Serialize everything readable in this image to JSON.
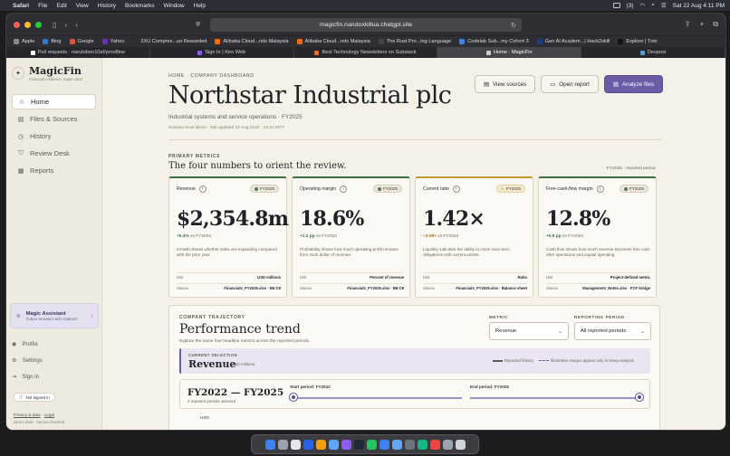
{
  "menubar": {
    "apple": "",
    "items": [
      "Safari",
      "File",
      "Edit",
      "View",
      "History",
      "Bookmarks",
      "Window",
      "Help"
    ],
    "status_badge": "(3)",
    "clock": "Sat 22 Aug 4:11 PM"
  },
  "browser": {
    "url": "magicfin.narutoxkillua.chatgpt.site",
    "bookmarks": [
      {
        "label": "Apple",
        "color": "#888888"
      },
      {
        "label": "Bing",
        "color": "#2b7cd3"
      },
      {
        "label": "Google",
        "color": "#e0523f"
      },
      {
        "label": "Yahoo",
        "color": "#6b2fb2"
      },
      {
        "label": "2XU Compres...un Rewarded",
        "color": "#2f2f2f"
      },
      {
        "label": "Alibaba Cloud...nds Malaysia",
        "color": "#ff6a00"
      },
      {
        "label": "Alibaba Cloud...nds Malaysia",
        "color": "#ff6a00"
      },
      {
        "label": "The Rust Pro...ing Language",
        "color": "#444444"
      },
      {
        "label": "Codelab Sub...my Cohort 3",
        "color": "#3b82f6"
      },
      {
        "label": "Gen AI Academ...| Hack2skill",
        "color": "#1e3a8a"
      },
      {
        "label": "Explore | Tnkr",
        "color": "#111111"
      }
    ],
    "tabs": [
      {
        "label": "Pull requests · narutoben10af/proofline",
        "color": "#ffffff",
        "active": false
      },
      {
        "label": "Sign In | Kiro Web",
        "color": "#8b5cf6",
        "active": false
      },
      {
        "label": "Best Technology Newsletters on Substack",
        "color": "#ff6719",
        "active": false
      },
      {
        "label": "Home · MagicFin",
        "color": "#cccccc",
        "active": true
      },
      {
        "label": "Devpost",
        "color": "#4d9de0",
        "active": false
      }
    ]
  },
  "sidebar": {
    "logo_glyph": "✦",
    "brand": "MagicFin",
    "tagline": "Financial evidence, made clear",
    "nav": [
      {
        "label": "Home",
        "icon": "⌂",
        "active": true
      },
      {
        "label": "Files & Sources",
        "icon": "▤",
        "active": false
      },
      {
        "label": "History",
        "icon": "◷",
        "active": false
      },
      {
        "label": "Review Desk",
        "icon": "⛉",
        "active": false
      },
      {
        "label": "Reports",
        "icon": "▦",
        "active": false
      }
    ],
    "assistant": {
      "title": "Magic Assistant",
      "subtitle": "Future answers with citations",
      "icon": "✧"
    },
    "links": [
      {
        "label": "Profile",
        "icon": "◉"
      },
      {
        "label": "Settings",
        "icon": "⚙"
      },
      {
        "label": "Sign in",
        "icon": "⇥"
      }
    ],
    "signed_status": "Not signed in",
    "privacy": "Privacy & data",
    "legal": "Legal",
    "demo_note": "Demo data · human checked"
  },
  "header": {
    "breadcrumb": "HOME · COMPANY DASHBOARD",
    "title": "Northstar Industrial plc",
    "subtitle": "Industrial systems and service operations · FY2025",
    "session": "Session-local demo · last updated 22 Aug 2026 · 10:24 MYT",
    "actions": {
      "view_sources": "View sources",
      "open_report": "Open report",
      "analyze_files": "Analyze files"
    }
  },
  "primary_metrics": {
    "label": "PRIMARY METRICS",
    "title": "The four numbers to orient the review.",
    "period_note": "FY2025 · reported period",
    "cards": [
      {
        "name": "Revenue",
        "badge": "FY2025",
        "value": "$2,354.8m",
        "delta": "+5.4%",
        "delta_suffix": "vs FY2024",
        "desc": "Growth shows whether sales are expanding compared with the prior year.",
        "unit_label": "Unit",
        "unit": "USD millions",
        "source_label": "Source",
        "source": "Financials_FY2025.xlsx · B5:C5",
        "status": "ok"
      },
      {
        "name": "Operating margin",
        "badge": "FY2025",
        "value": "18.6%",
        "delta": "+1.2 pp",
        "delta_suffix": "vs FY2024",
        "desc": "Profitability shows how much operating profit remains from each dollar of revenue.",
        "unit_label": "Unit",
        "unit": "Percent of revenue",
        "source_label": "Source",
        "source": "Financials_FY2025.xlsx · B8:C8",
        "status": "ok"
      },
      {
        "name": "Current ratio",
        "badge": "FY2025",
        "value": "1.42×",
        "delta": "−0.08×",
        "delta_suffix": "vs FY2024",
        "desc": "Liquidity indicates the ability to cover near-term obligations with current assets.",
        "unit_label": "Unit",
        "unit": "Ratio",
        "source_label": "Source",
        "source": "Financials_FY2025.xlsx · Balance sheet",
        "status": "warn"
      },
      {
        "name": "Free-cash-flow margin",
        "badge": "FY2025",
        "value": "12.8%",
        "delta": "+0.9 pp",
        "delta_suffix": "vs FY2024",
        "desc": "Cash flow shows how much revenue becomes free cash after operations and capital spending.",
        "unit_label": "Unit",
        "unit": "Project-defined metric",
        "source_label": "Source",
        "source": "Management_Notes.xlsx · FCF bridge",
        "status": "ok"
      }
    ]
  },
  "trajectory": {
    "label": "COMPANY TRAJECTORY",
    "title": "Performance trend",
    "subtitle": "Explore the same four headline metrics across the reported periods.",
    "metric_label": "METRIC",
    "metric_value": "Revenue",
    "period_label": "REPORTING PERIOD",
    "period_value": "All reported periods",
    "current_label": "CURRENT SELECTION",
    "current_name": "Revenue",
    "current_unit": "USD millions",
    "legend_reported": "Reported history",
    "legend_illustrative": "Illustrative ranges appear only in Deep analysis",
    "range_title": "FY2022 — FY2025",
    "range_sub": "4 reported periods selected",
    "start_label": "Start period: FY2022",
    "end_label": "End period: FY2025",
    "axis_unit": "USD"
  },
  "dock": {
    "colors": [
      "#3b82f6",
      "#9ca3af",
      "#e5e7eb",
      "#2563eb",
      "#f59e0b",
      "#60a5fa",
      "#8b5cf6",
      "#1f2937",
      "#22c55e",
      "#3b82f6",
      "#60a5fa",
      "#6b7280",
      "#10b981",
      "#ef4444",
      "#9ca3af",
      "#d1d5db"
    ]
  }
}
